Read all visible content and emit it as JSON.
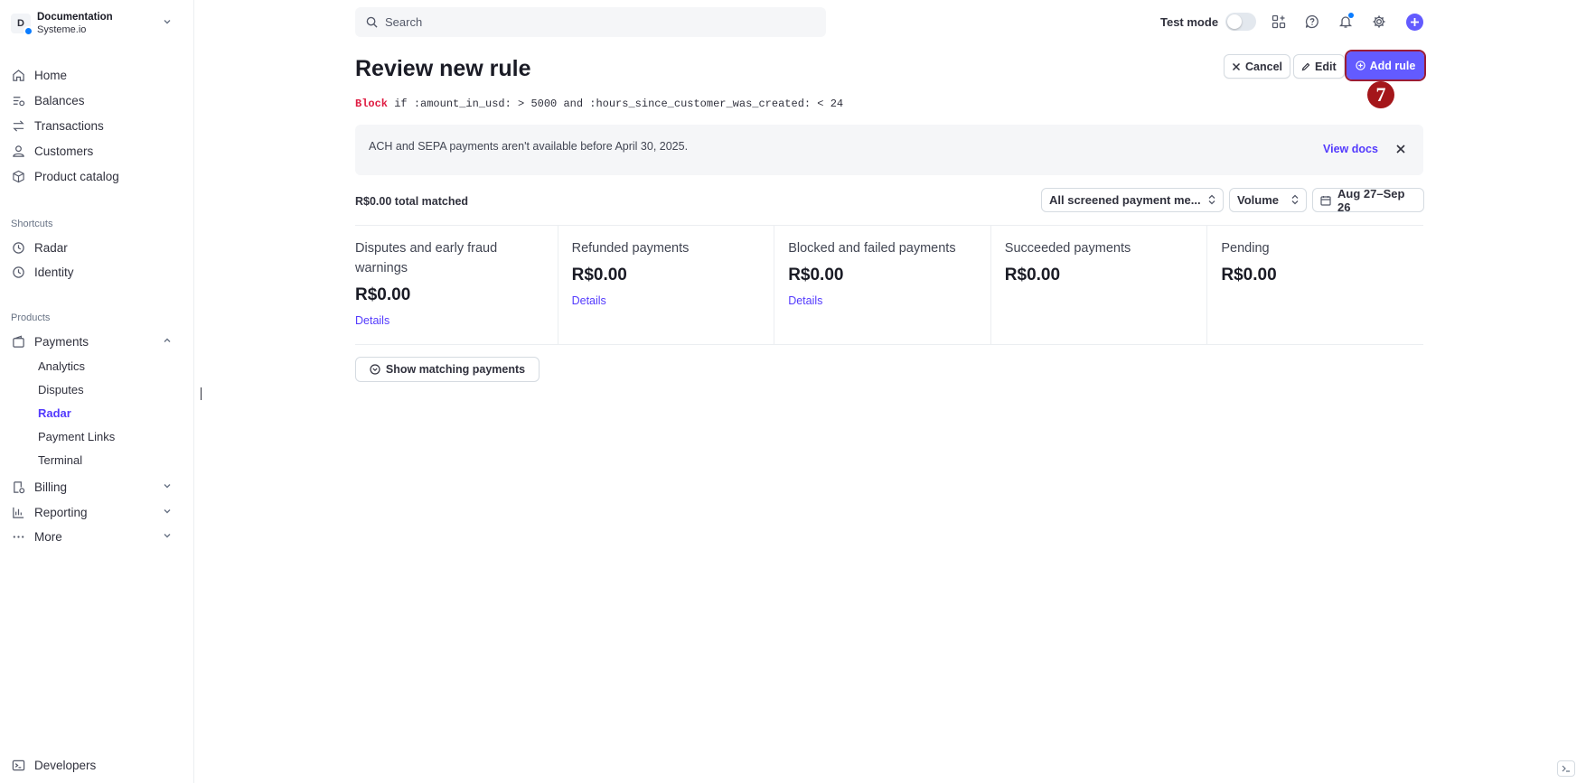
{
  "account": {
    "name": "Documentation",
    "sub": "Systeme.io",
    "initial": "D"
  },
  "nav": {
    "home": "Home",
    "balances": "Balances",
    "transactions": "Transactions",
    "customers": "Customers",
    "product_catalog": "Product catalog",
    "shortcuts_title": "Shortcuts",
    "radar": "Radar",
    "identity": "Identity",
    "products_title": "Products",
    "payments": "Payments",
    "payments_sub": [
      "Analytics",
      "Disputes",
      "Radar",
      "Payment Links",
      "Terminal"
    ],
    "billing": "Billing",
    "reporting": "Reporting",
    "more": "More",
    "developers": "Developers"
  },
  "topbar": {
    "search_placeholder": "Search",
    "test_mode_label": "Test mode",
    "test_mode_on": false
  },
  "header": {
    "title": "Review new rule",
    "cancel_label": "Cancel",
    "edit_label": "Edit",
    "add_rule_label": "Add rule",
    "step_badge": "7"
  },
  "rule": {
    "action": "Block",
    "expression": " if :amount_in_usd: > 5000 and :hours_since_customer_was_created: < 24"
  },
  "banner": {
    "text": "ACH and SEPA payments aren't available before April 30, 2025.",
    "link": "View docs"
  },
  "filters": {
    "matched_total": "R$0.00 total matched",
    "payment_method": "All screened payment me...",
    "metric": "Volume",
    "date_range": "Aug 27–Sep 26"
  },
  "metrics": [
    {
      "label": "Disputes and early fraud warnings",
      "value": "R$0.00",
      "link": "Details"
    },
    {
      "label": "Refunded payments",
      "value": "R$0.00",
      "link": "Details"
    },
    {
      "label": "Blocked and failed payments",
      "value": "R$0.00",
      "link": "Details"
    },
    {
      "label": "Succeeded payments",
      "value": "R$0.00",
      "link": ""
    },
    {
      "label": "Pending",
      "value": "R$0.00",
      "link": ""
    }
  ],
  "actions": {
    "show_matching": "Show matching payments"
  },
  "colors": {
    "accent": "#635bff",
    "link": "#533afd",
    "rule_keyword": "#df1b41",
    "badge": "#a4161a"
  }
}
